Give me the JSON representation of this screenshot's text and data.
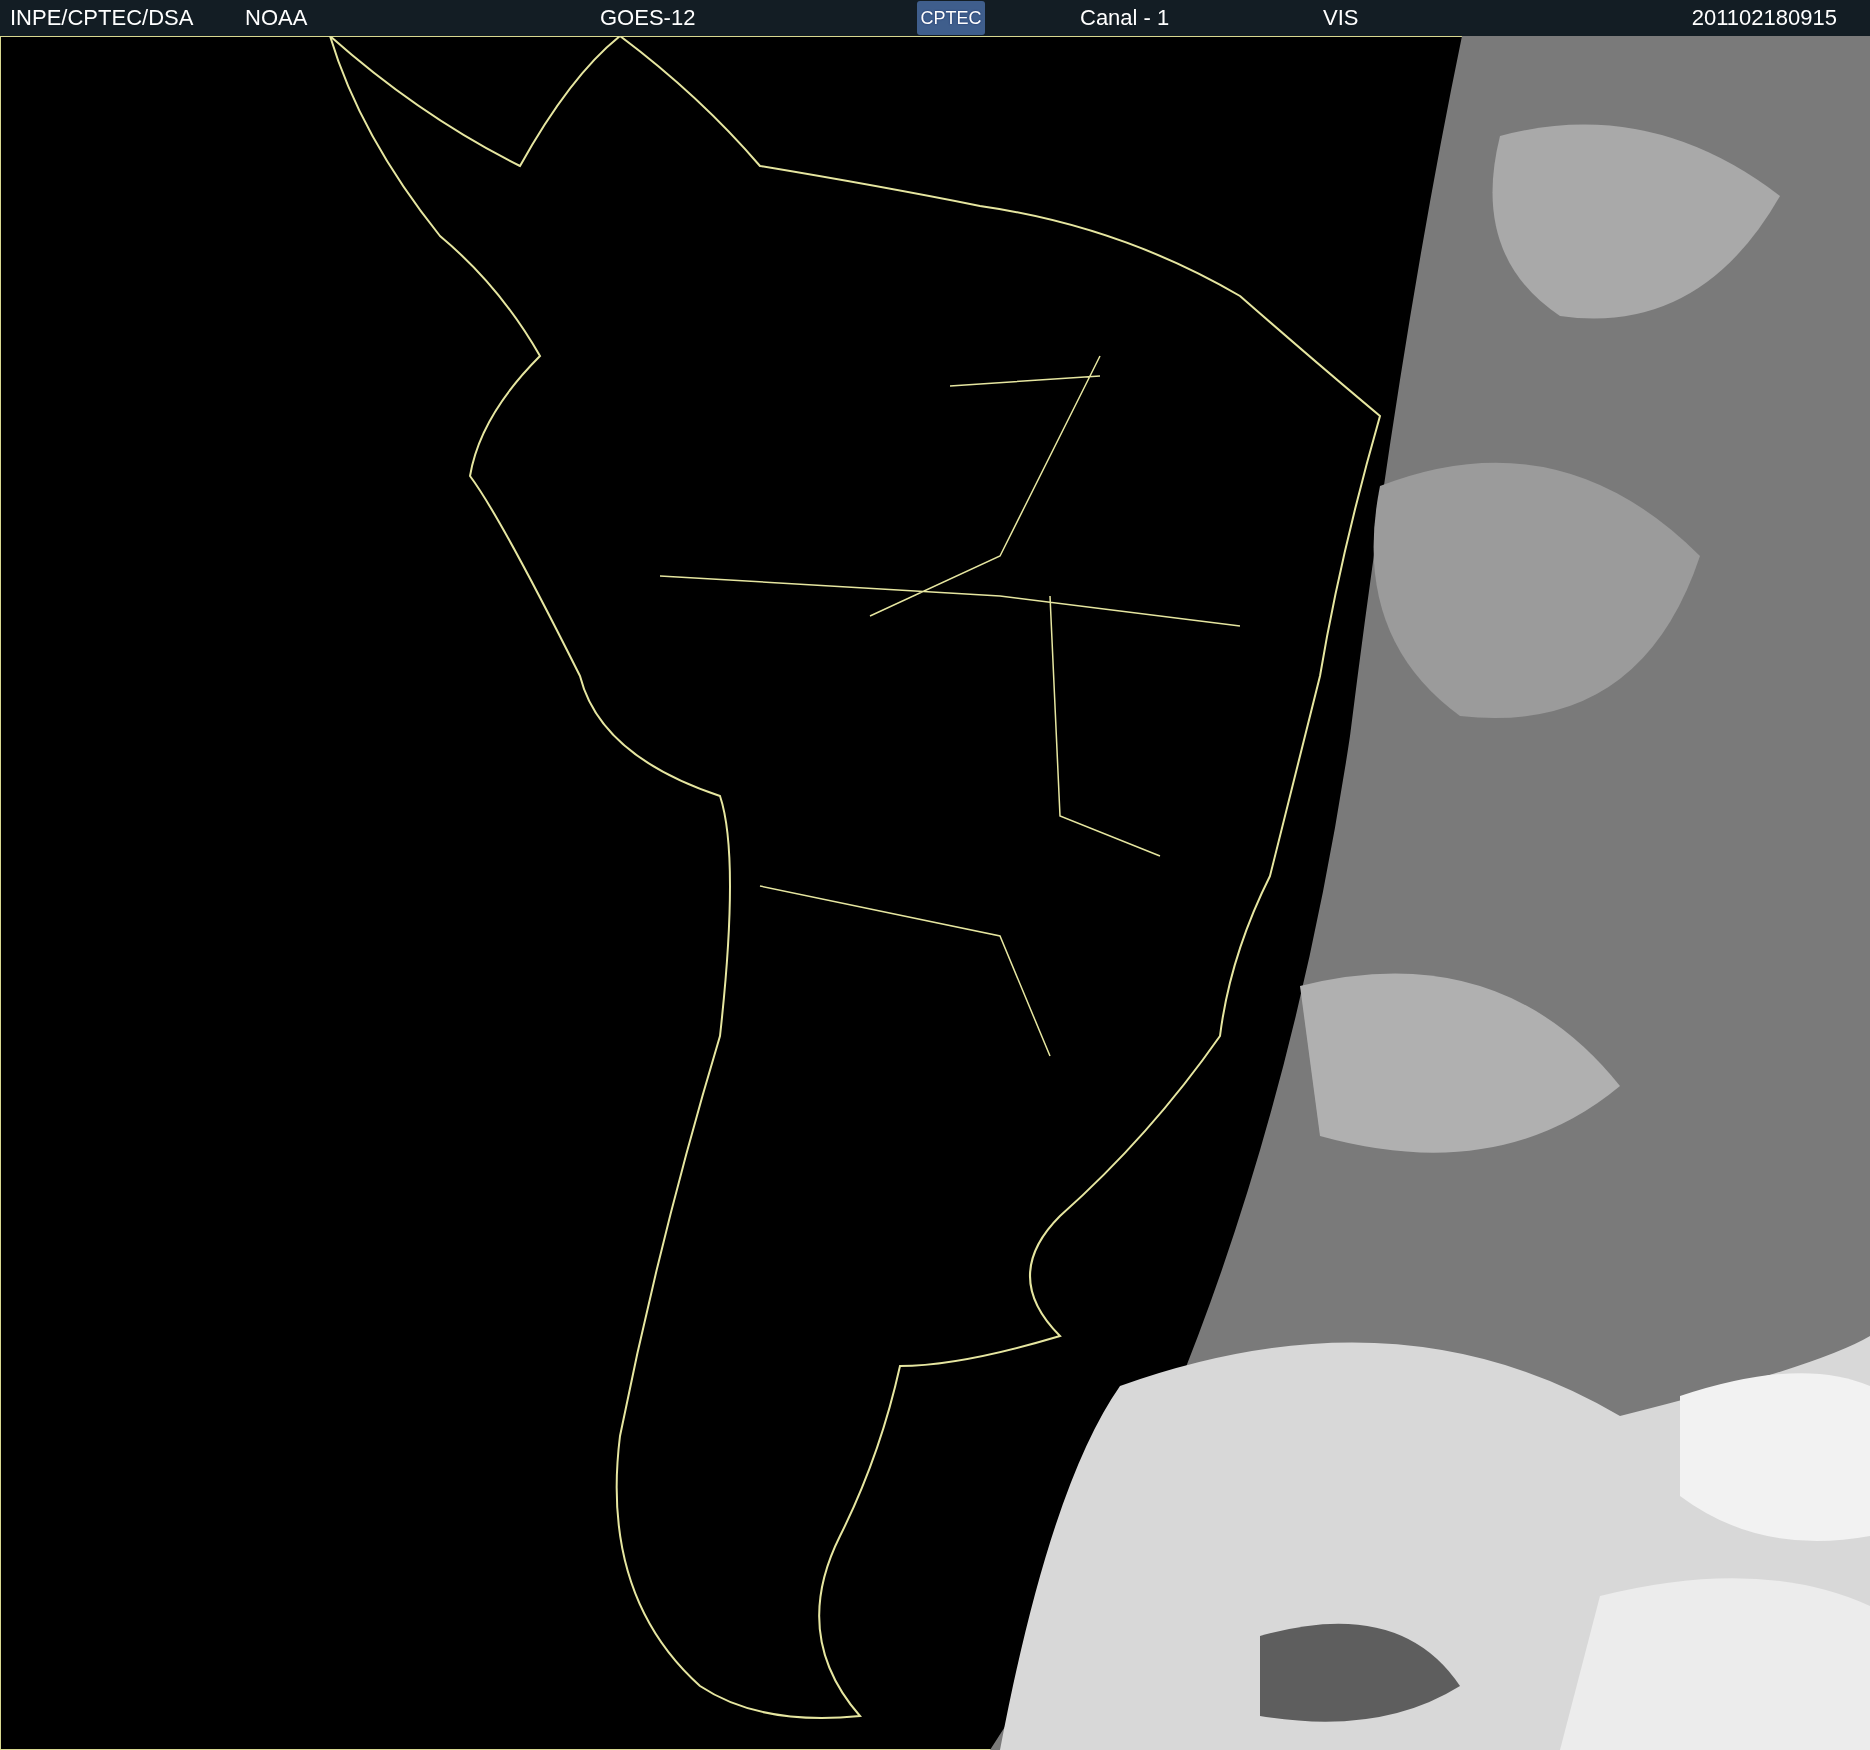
{
  "header": {
    "items": [
      {
        "kind": "text",
        "label": "INPE/CPTEC/DSA"
      },
      {
        "kind": "text",
        "label": "NOAA"
      },
      {
        "kind": "text",
        "label": "GOES-12"
      },
      {
        "kind": "logo",
        "label": "CPTEC"
      },
      {
        "kind": "text",
        "label": "Canal - 1"
      },
      {
        "kind": "text",
        "label": "VIS"
      },
      {
        "kind": "text",
        "label": "201102180915"
      }
    ]
  }
}
